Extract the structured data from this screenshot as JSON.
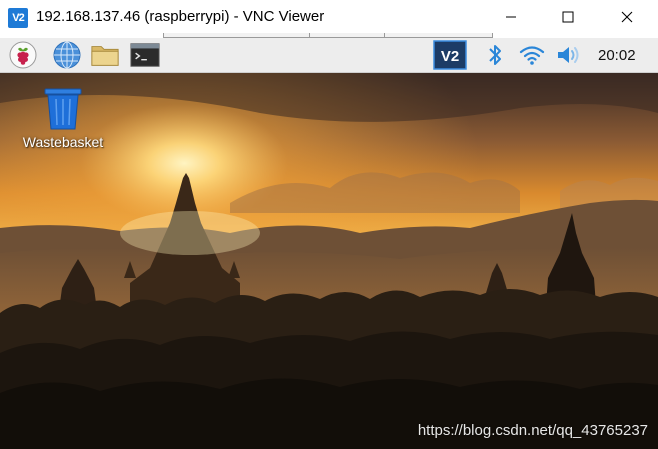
{
  "window": {
    "title": "192.168.137.46 (raspberrypi) - VNC Viewer",
    "app_icon_text": "V2",
    "app_icon_color": "#1e7ad6",
    "controls": [
      "minimize-icon",
      "maximize-icon",
      "close-icon"
    ]
  },
  "taskbar": {
    "launchers": [
      {
        "name": "raspberry-menu",
        "icon": "raspberry-icon"
      },
      {
        "name": "web-browser",
        "icon": "globe-icon"
      },
      {
        "name": "file-manager",
        "icon": "folder-icon"
      },
      {
        "name": "terminal",
        "icon": "terminal-icon"
      }
    ],
    "tray": [
      {
        "name": "vnc-server",
        "icon": "vnc-icon",
        "color": "#2a73c4"
      },
      {
        "name": "bluetooth",
        "icon": "bluetooth-icon",
        "color": "#2a86d8"
      },
      {
        "name": "wifi",
        "icon": "wifi-icon",
        "color": "#2a86d8"
      },
      {
        "name": "volume",
        "icon": "speaker-icon",
        "color": "#2a86d8"
      }
    ],
    "clock": "20:02",
    "background": "#ededed"
  },
  "desktop": {
    "icons": [
      {
        "label": "Wastebasket",
        "icon": "wastebasket-icon",
        "color": "#1e6fd9"
      }
    ],
    "wallpaper": "sunset-temples",
    "watermark": "https://blog.csdn.net/qq_43765237"
  }
}
